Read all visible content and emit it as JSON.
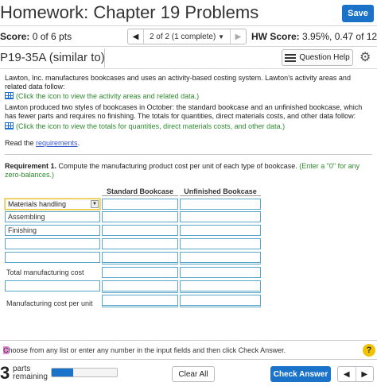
{
  "header": {
    "title": "Homework: Chapter 19 Problems",
    "save_label": "Save"
  },
  "scorebar": {
    "score_label": "Score:",
    "score_value": "0 of 6 pts",
    "pager_text": "2 of 2 (1 complete)",
    "hw_label": "HW Score:",
    "hw_value": "3.95%, 0.47 of 12..."
  },
  "question": {
    "id": "P19-35A (similar to)",
    "help_label": "Question Help"
  },
  "problem": {
    "para1": "Lawton, Inc. manufactures bookcases and uses an activity-based costing system. Lawton's activity areas and related data follow:",
    "link1": "(Click the icon to view the activity areas and related data.)",
    "para2": "Lawton produced two styles of bookcases in October: the standard bookcase and an unfinished bookcase, which has fewer parts and requires no finishing. The totals for quantities, direct materials costs, and other data follow:",
    "link2": "(Click the icon to view the totals for quantities, direct materials costs, and other data.)",
    "read_prefix": "Read the ",
    "read_link": "requirements",
    "read_suffix": "."
  },
  "requirement": {
    "label": "Requirement 1.",
    "text": " Compute the manufacturing product cost per unit of each type of bookcase. ",
    "hint": "(Enter a \"0\" for any zero-balances.)"
  },
  "table": {
    "col1": "Standard Bookcase",
    "col2": "Unfinished Bookcase",
    "dropdown_value": "Materials handling",
    "row_labels": [
      "Assembling",
      "Finishing"
    ],
    "total_label": "Total manufacturing cost",
    "unit_label": "Manufacturing cost per unit"
  },
  "footer": {
    "instruction_first": "C",
    "instruction_rest": "hoose from any list or enter any number in the input fields and then click Check Answer.",
    "help_glyph": "?",
    "parts_num": "3",
    "parts_line1": "parts",
    "parts_line2": "remaining",
    "progress_fraction": 0.33,
    "clear_label": "Clear All",
    "check_label": "Check Answer"
  },
  "icons": {
    "save": "save-button",
    "pager_prev": "chevron-left-icon",
    "pager_next": "chevron-right-icon",
    "help": "list-icon",
    "settings": "gear-icon",
    "data_table": "table-icon",
    "dropdown": "chevron-down-icon",
    "question_help": "question-mark-icon"
  },
  "colors": {
    "accent": "#1a73c9",
    "link_green": "#2e8b2e",
    "input_border": "#5aa6c8",
    "help_yellow": "#f2c200"
  }
}
